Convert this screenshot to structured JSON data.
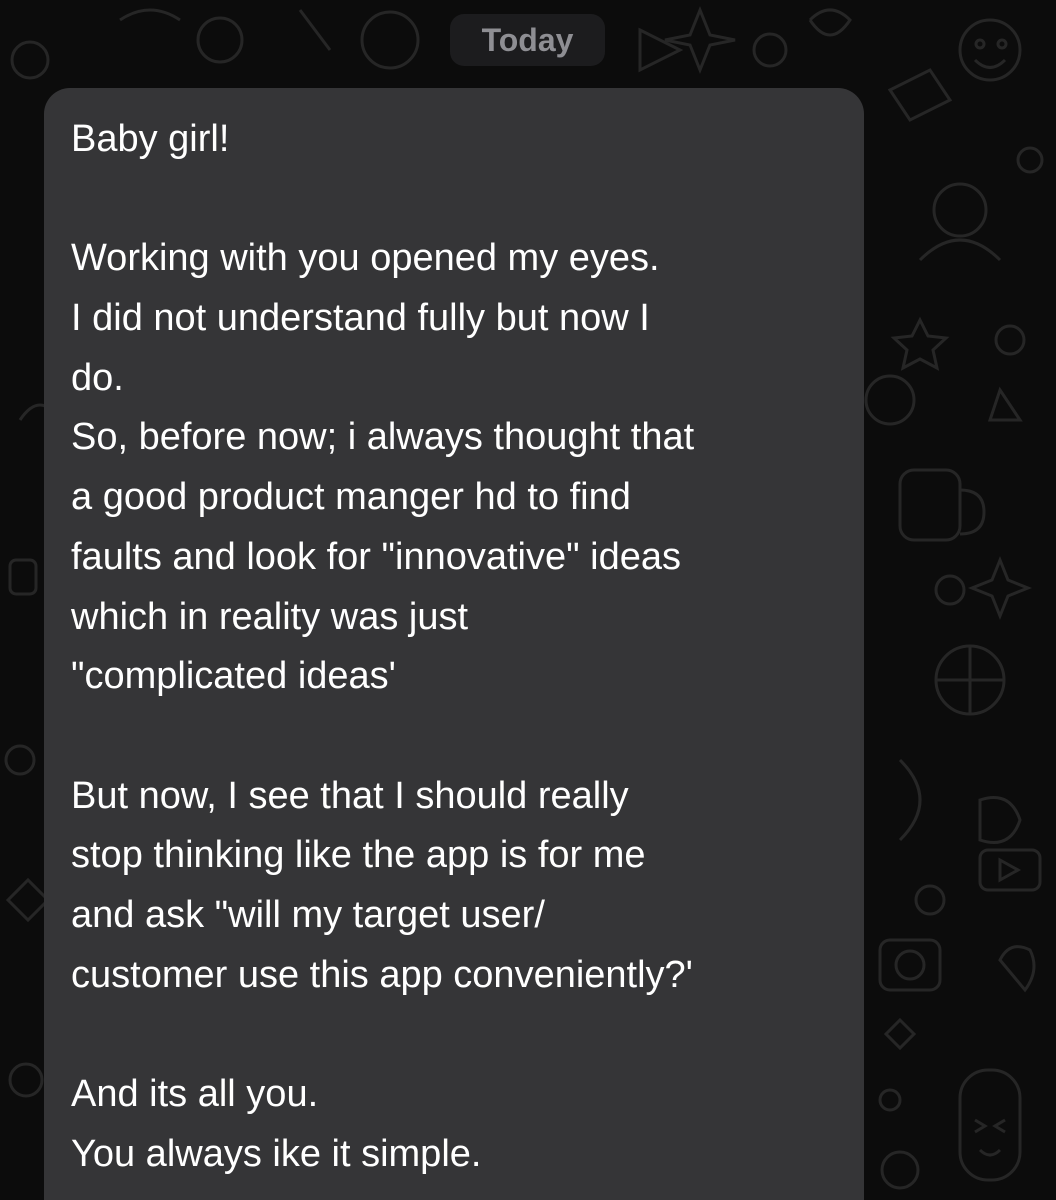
{
  "date_chip": {
    "label": "Today"
  },
  "message": {
    "lines": [
      "Baby girl!",
      "",
      "Working with you opened my eyes.",
      "I did not understand fully but now I",
      "do.",
      "So, before now; i always thought that",
      "a good product manger hd to find",
      "faults and look for \"innovative\" ideas",
      "which in reality was just",
      "\"complicated ideas'",
      "",
      "But now, I see that I should really",
      "stop thinking like the app is for me",
      "and ask \"will my target user/",
      "customer use this app conveniently?'",
      "",
      "And its all you.",
      "You always ike it simple."
    ]
  },
  "colors": {
    "background": "#0c0c0c",
    "bubble": "#353537",
    "text": "#ffffff",
    "chip_background": "#1c1c1e",
    "chip_text": "#8e8e93"
  }
}
